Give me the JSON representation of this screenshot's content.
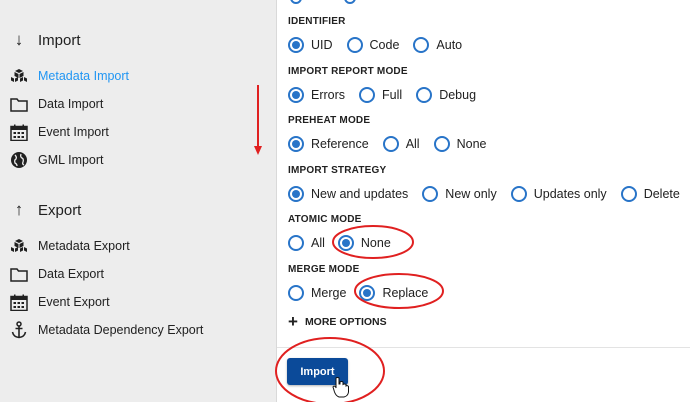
{
  "sidebar": {
    "import_section": {
      "title": "Import",
      "icon": "arrow-down-icon"
    },
    "import_items": [
      {
        "label": "Metadata Import",
        "icon": "cubes-icon",
        "active": true
      },
      {
        "label": "Data Import",
        "icon": "folder-icon",
        "active": false
      },
      {
        "label": "Event Import",
        "icon": "calendar-icon",
        "active": false
      },
      {
        "label": "GML Import",
        "icon": "globe-icon",
        "active": false
      }
    ],
    "export_section": {
      "title": "Export",
      "icon": "arrow-up-icon"
    },
    "export_items": [
      {
        "label": "Metadata Export",
        "icon": "cubes-icon"
      },
      {
        "label": "Data Export",
        "icon": "folder-icon"
      },
      {
        "label": "Event Export",
        "icon": "calendar-icon"
      },
      {
        "label": "Metadata Dependency Export",
        "icon": "anchor-icon"
      }
    ]
  },
  "form": {
    "identifier": {
      "title": "IDENTIFIER",
      "options": [
        "UID",
        "Code",
        "Auto"
      ],
      "selected": "UID"
    },
    "import_report_mode": {
      "title": "IMPORT REPORT MODE",
      "options": [
        "Errors",
        "Full",
        "Debug"
      ],
      "selected": "Errors"
    },
    "preheat_mode": {
      "title": "PREHEAT MODE",
      "options": [
        "Reference",
        "All",
        "None"
      ],
      "selected": "Reference"
    },
    "import_strategy": {
      "title": "IMPORT STRATEGY",
      "options": [
        "New and updates",
        "New only",
        "Updates only",
        "Delete"
      ],
      "selected": "New and updates"
    },
    "atomic_mode": {
      "title": "ATOMIC MODE",
      "options": [
        "All",
        "None"
      ],
      "selected": "None"
    },
    "merge_mode": {
      "title": "MERGE MODE",
      "options": [
        "Merge",
        "Replace"
      ],
      "selected": "Replace"
    },
    "more_options": {
      "label": "MORE OPTIONS",
      "icon": "plus-icon"
    },
    "import_button": {
      "label": "Import"
    }
  },
  "annotations": {
    "highlight_color": "#e02020",
    "accent_color": "#2874c8",
    "button_color": "#0b4a99",
    "active_link_color": "#2196f3"
  }
}
